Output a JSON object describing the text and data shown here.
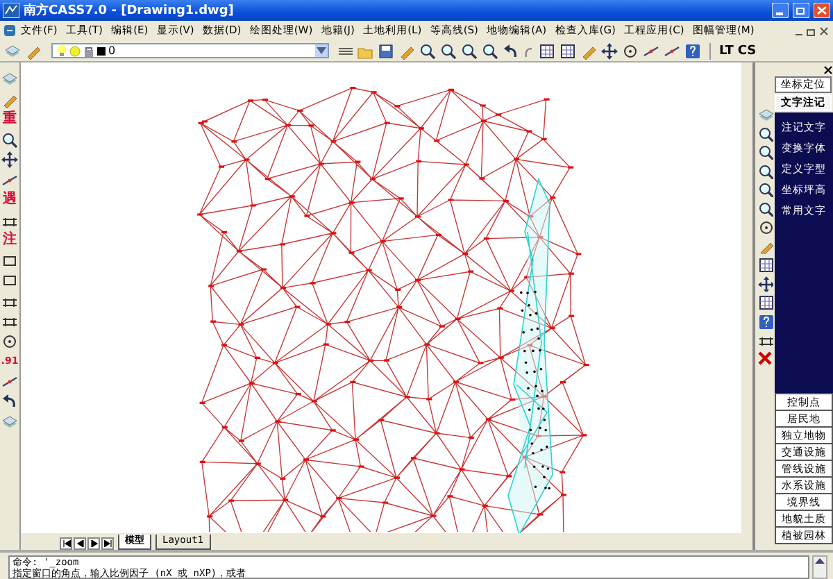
{
  "window": {
    "title": "南方CASS7.0 - [Drawing1.dwg]"
  },
  "menu": [
    "文件(F)",
    "工具(T)",
    "编辑(E)",
    "显示(V)",
    "数据(D)",
    "绘图处理(W)",
    "地籍(J)",
    "土地利用(L)",
    "等高线(S)",
    "地物编辑(A)",
    "检查入库(G)",
    "工程应用(C)",
    "图幅管理(M)"
  ],
  "layer_combo": {
    "value": "0"
  },
  "toolbar_texts": [
    "LT",
    "CS"
  ],
  "left_toolbar": [
    {
      "kind": "icon"
    },
    {
      "kind": "icon"
    },
    {
      "kind": "glyph",
      "text": "重"
    },
    {
      "kind": "icon"
    },
    {
      "kind": "icon"
    },
    {
      "kind": "icon"
    },
    {
      "kind": "glyph",
      "text": "遇"
    },
    {
      "kind": "icon"
    },
    {
      "kind": "glyph",
      "text": "注"
    },
    {
      "kind": "icon"
    },
    {
      "kind": "icon"
    },
    {
      "kind": "icon"
    },
    {
      "kind": "icon"
    },
    {
      "kind": "icon"
    },
    {
      "kind": "glyph",
      "text": ".91"
    },
    {
      "kind": "icon"
    },
    {
      "kind": "icon"
    },
    {
      "kind": "icon"
    }
  ],
  "right_panel": {
    "modes": [
      {
        "label": "坐标定位",
        "selected": false
      },
      {
        "label": "文字注记",
        "selected": true
      }
    ],
    "items": [
      "注记文字",
      "变换字体",
      "定义字型",
      "坐标坪高",
      "常用文字"
    ],
    "categories": [
      "控制点",
      "居民地",
      "独立地物",
      "交通设施",
      "管线设施",
      "水系设施",
      "境界线",
      "地貌土质",
      "植被园林"
    ]
  },
  "layout_tabs": [
    {
      "label": "模型",
      "selected": true
    },
    {
      "label": "Layout1",
      "selected": false
    }
  ],
  "command_lines": [
    "命令: '_zoom",
    "指定窗口的角点，输入比例因子 (nX 或 nXP)，或者"
  ]
}
